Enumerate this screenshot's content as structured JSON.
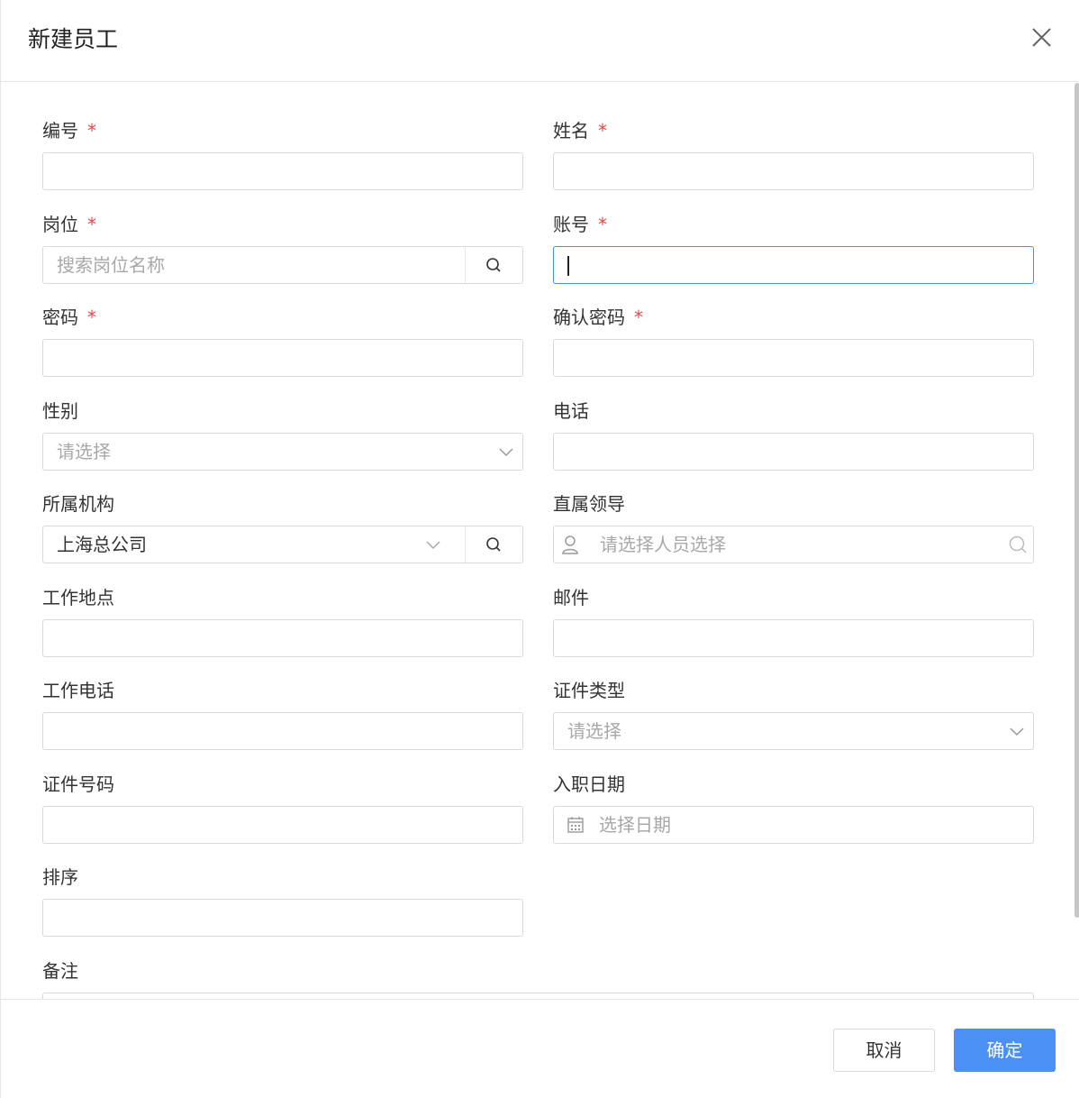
{
  "dialog": {
    "title": "新建员工"
  },
  "form": {
    "code": {
      "label": "编号",
      "required": "*",
      "value": ""
    },
    "name": {
      "label": "姓名",
      "required": "*",
      "value": ""
    },
    "position": {
      "label": "岗位",
      "required": "*",
      "placeholder": "搜索岗位名称"
    },
    "account": {
      "label": "账号",
      "required": "*",
      "value": ""
    },
    "password": {
      "label": "密码",
      "required": "*",
      "value": ""
    },
    "confirm_password": {
      "label": "确认密码",
      "required": "*",
      "value": ""
    },
    "gender": {
      "label": "性别",
      "placeholder": "请选择"
    },
    "phone": {
      "label": "电话",
      "value": ""
    },
    "organization": {
      "label": "所属机构",
      "value": "上海总公司"
    },
    "leader": {
      "label": "直属领导",
      "placeholder": "请选择人员选择"
    },
    "work_location": {
      "label": "工作地点",
      "value": ""
    },
    "email": {
      "label": "邮件",
      "value": ""
    },
    "work_phone": {
      "label": "工作电话",
      "value": ""
    },
    "id_type": {
      "label": "证件类型",
      "placeholder": "请选择"
    },
    "id_number": {
      "label": "证件号码",
      "value": ""
    },
    "hire_date": {
      "label": "入职日期",
      "placeholder": "选择日期"
    },
    "sort": {
      "label": "排序",
      "value": ""
    },
    "remark": {
      "label": "备注",
      "value": ""
    }
  },
  "footer": {
    "cancel_label": "取消",
    "ok_label": "确定"
  },
  "colors": {
    "primary": "#4a90f5",
    "required": "#e5484d",
    "focus_border": "#4a90e2"
  },
  "icons": {
    "close": "close-icon",
    "search": "search-icon",
    "chevron": "chevron-down-icon",
    "user": "user-icon",
    "calendar": "calendar-icon"
  }
}
